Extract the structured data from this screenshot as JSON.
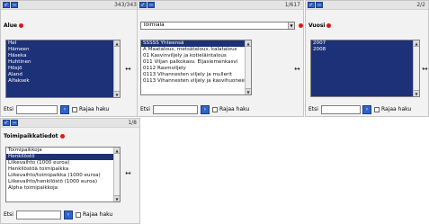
{
  "panels": {
    "alue": {
      "count": "343/343",
      "title": "Alue",
      "items": [
        "Hel",
        "Hämeen",
        "Häseka",
        "Huhtinen",
        "Hösjö",
        "Aland",
        "Alfaksek"
      ],
      "selected_index": 0,
      "search_label": "Etsi",
      "search_value": "",
      "checkbox_label": "Rajaa haku"
    },
    "toimiala": {
      "count": "1/617",
      "dropdown_value": "Toimiala",
      "items": [
        "SSSSS Yhteensä",
        "A Maatalous, metsätalous, kalatalous",
        "01 Kasvinviljely ja kotieläintalous",
        "011 Viljan palkokasv. Eljasiemenkasvi",
        "0112 Rasmviljely",
        "0113 Vihannesten viljely ja mullerit",
        "0113 Vihannesten viljely ja kasvihuoneet"
      ],
      "selected_index": 0,
      "search_label": "Etsi",
      "search_value": "",
      "checkbox_label": "Rajaa haku"
    },
    "vuosi": {
      "count": "2/2",
      "title": "Vuosi",
      "items": [
        "2007",
        "2008"
      ],
      "search_label": "Etsi",
      "search_value": "",
      "checkbox_label": "Rajaa haku"
    },
    "toimipaikkatiedot": {
      "count": "1/8",
      "title": "Toimipaikkatiedot",
      "items": [
        "Toimipaikkoja",
        "Henkilöstö",
        "Liikevaihto (1000 euroa)",
        "Henkilöstöä toimipaikka",
        "Liikevaihto/toimipaikka (1000 euroa)",
        "Liikevaihto/henkilöstö (1000 euroa)",
        "Alpha toimipaikkoja"
      ],
      "selected_index": 1,
      "search_label": "Etsi",
      "search_value": "",
      "checkbox_label": "Rajaa haku"
    }
  },
  "icons": {
    "select_all": "check-icon",
    "deselect": "minus-icon",
    "swap": "swap-arrows-icon",
    "search_go": "arrow-right-icon"
  },
  "colors": {
    "selected_bg": "#1c3177",
    "button_bg": "#2f63c9",
    "required_dot": "#d81818"
  }
}
